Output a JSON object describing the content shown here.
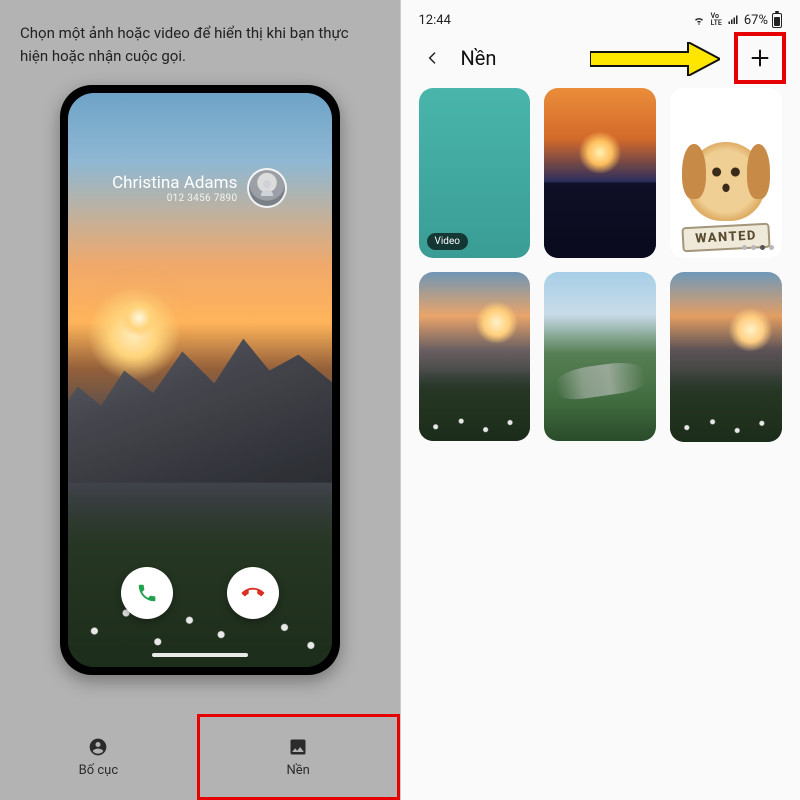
{
  "left": {
    "intro": "Chọn một ảnh hoặc video để hiển thị khi bạn thực hiện hoặc nhận cuộc gọi.",
    "caller_name": "Christina Adams",
    "caller_number": "012 3456 7890",
    "tabs": {
      "layout": "Bố cục",
      "background": "Nền"
    }
  },
  "right": {
    "status": {
      "time": "12:44",
      "network_badge": "VoLTE",
      "battery_text": "67%"
    },
    "title": "Nền",
    "video_badge": "Video",
    "wanted_text": "WANTED"
  }
}
